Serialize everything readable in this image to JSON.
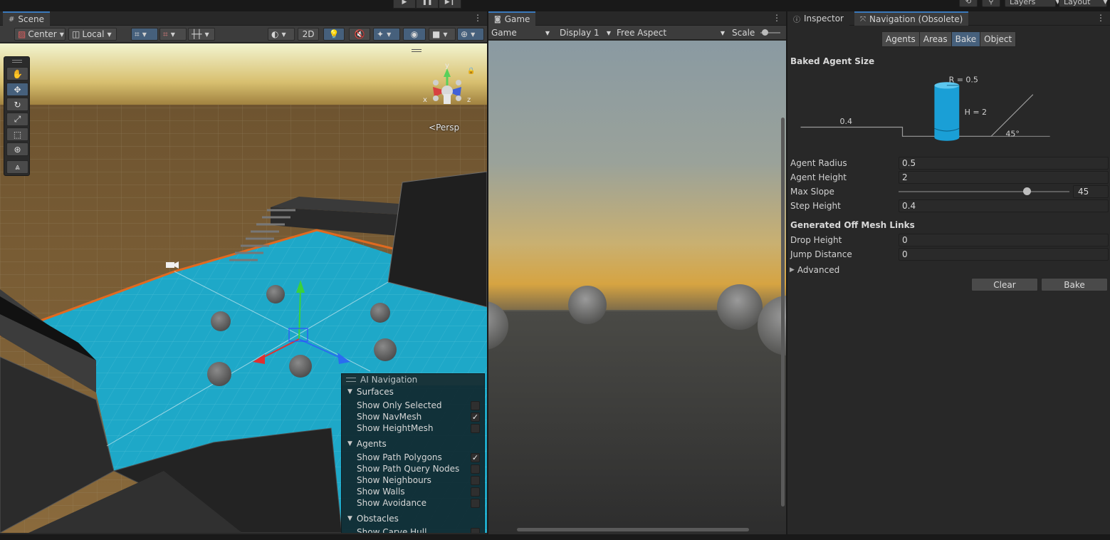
{
  "toolbar": {
    "play_icon": "play-icon",
    "pause_icon": "pause-icon",
    "step_icon": "step-icon",
    "layers_label": "Layers",
    "layout_label": "Layout"
  },
  "scene": {
    "tab_label": "Scene",
    "pivot_label": "Center",
    "space_label": "Local",
    "mode_2d": "2D",
    "persp_label": "Persp",
    "gizmo_axes": {
      "x": "x",
      "y": "y",
      "z": "z"
    }
  },
  "ai_navigation": {
    "title": "AI Navigation",
    "surfaces": {
      "label": "Surfaces",
      "items": [
        {
          "label": "Show Only Selected",
          "checked": false
        },
        {
          "label": "Show NavMesh",
          "checked": true
        },
        {
          "label": "Show HeightMesh",
          "checked": false
        }
      ]
    },
    "agents": {
      "label": "Agents",
      "items": [
        {
          "label": "Show Path Polygons",
          "checked": true
        },
        {
          "label": "Show Path Query Nodes",
          "checked": false
        },
        {
          "label": "Show Neighbours",
          "checked": false
        },
        {
          "label": "Show Walls",
          "checked": false
        },
        {
          "label": "Show Avoidance",
          "checked": false
        }
      ]
    },
    "obstacles": {
      "label": "Obstacles",
      "items": [
        {
          "label": "Show Carve Hull",
          "checked": false
        }
      ]
    }
  },
  "game": {
    "tab_label": "Game",
    "view_label": "Game",
    "display_label": "Display 1",
    "aspect_label": "Free Aspect",
    "scale_label": "Scale"
  },
  "inspector": {
    "tab_inspector": "Inspector",
    "tab_navigation": "Navigation (Obsolete)",
    "nav_tabs": [
      "Agents",
      "Areas",
      "Bake",
      "Object"
    ],
    "active_nav_tab": "Bake",
    "baked_agent_size_title": "Baked Agent Size",
    "diagram": {
      "radius_label": "R = 0.5",
      "height_label": "H = 2",
      "step_label": "0.4",
      "slope_label": "45°"
    },
    "properties": [
      {
        "label": "Agent Radius",
        "value": "0.5"
      },
      {
        "label": "Agent Height",
        "value": "2"
      },
      {
        "label": "Max Slope",
        "value": "45"
      },
      {
        "label": "Step Height",
        "value": "0.4"
      }
    ],
    "max_slope_fraction": 0.75,
    "off_mesh_title": "Generated Off Mesh Links",
    "off_mesh_properties": [
      {
        "label": "Drop Height",
        "value": "0"
      },
      {
        "label": "Jump Distance",
        "value": "0"
      }
    ],
    "advanced_label": "Advanced",
    "clear_button": "Clear",
    "bake_button": "Bake"
  },
  "colors": {
    "accent": "#3a79bb",
    "navmesh": "#1ea8c8",
    "agent_cylinder": "#1a9fd6"
  }
}
